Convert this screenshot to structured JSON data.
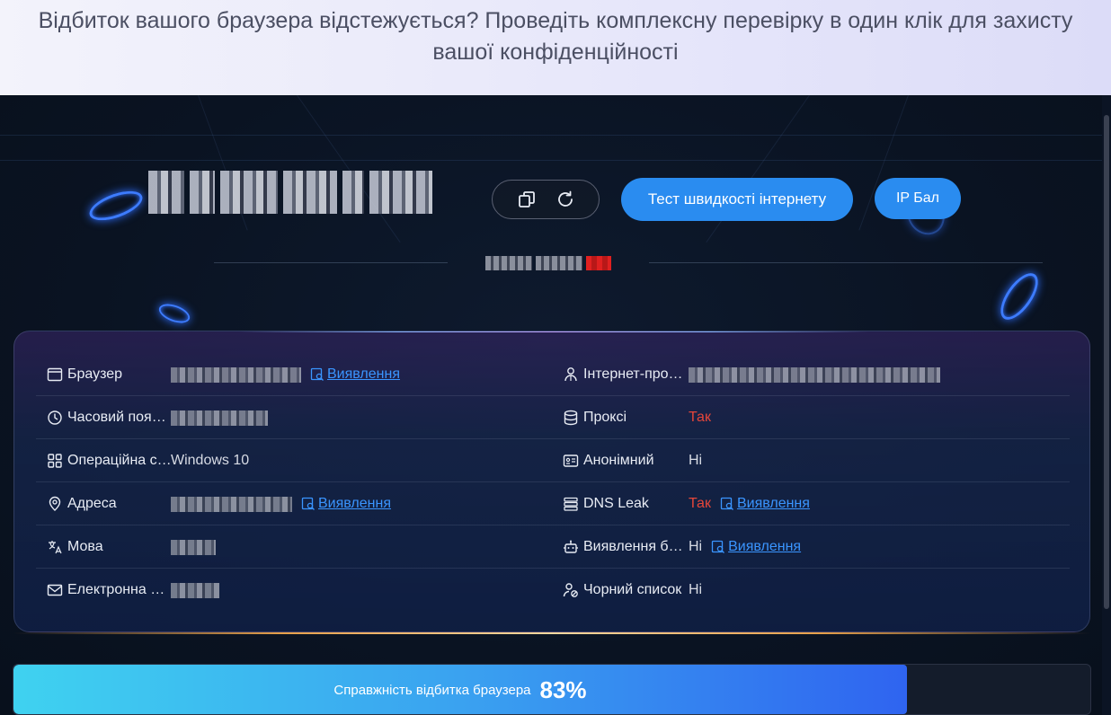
{
  "banner": {
    "line1": "Відбиток вашого браузера відстежується? Проведіть комплексну перевірку в один клік для захисту",
    "line2": "вашої конфіденційності"
  },
  "hero": {
    "ip_label": "111.199.1.99",
    "speed_test_label": "Тест швидкості інтернету",
    "ip_score_label": "IP Бал"
  },
  "info": {
    "left": [
      {
        "icon": "browser-window-icon",
        "label": "Браузер",
        "value": "",
        "detect": "Виявлення"
      },
      {
        "icon": "clock-icon",
        "label": "Часовий поя…",
        "value": "",
        "detect": ""
      },
      {
        "icon": "grid-icon",
        "label": "Операційна с…",
        "value": "Windows 10",
        "detect": ""
      },
      {
        "icon": "location-pin-icon",
        "label": "Адреса",
        "value": "",
        "detect": "Виявлення"
      },
      {
        "icon": "translate-icon",
        "label": "Мова",
        "value": "",
        "detect": ""
      },
      {
        "icon": "mail-icon",
        "label": "Електронна …",
        "value": "",
        "detect": ""
      }
    ],
    "right": [
      {
        "icon": "user-network-icon",
        "label": "Інтернет-про…",
        "value": "",
        "detect": ""
      },
      {
        "icon": "database-icon",
        "label": "Проксі",
        "value": "Так",
        "detect": ""
      },
      {
        "icon": "id-card-icon",
        "label": "Анонімний",
        "value": "Ні",
        "detect": ""
      },
      {
        "icon": "server-list-icon",
        "label": "DNS Leak",
        "value": "Так",
        "detect": "Виявлення"
      },
      {
        "icon": "robot-icon",
        "label": "Виявлення б…",
        "value": "Ні",
        "detect": "Виявлення"
      },
      {
        "icon": "user-block-icon",
        "label": "Чорний список",
        "value": "Ні",
        "detect": ""
      }
    ]
  },
  "progress": {
    "label": "Справжність відбитка браузера",
    "percent_text": "83%",
    "value": 0.83
  },
  "colors": {
    "accent": "#2a8cf0",
    "danger": "#e5463a",
    "link": "#3a95ff"
  }
}
